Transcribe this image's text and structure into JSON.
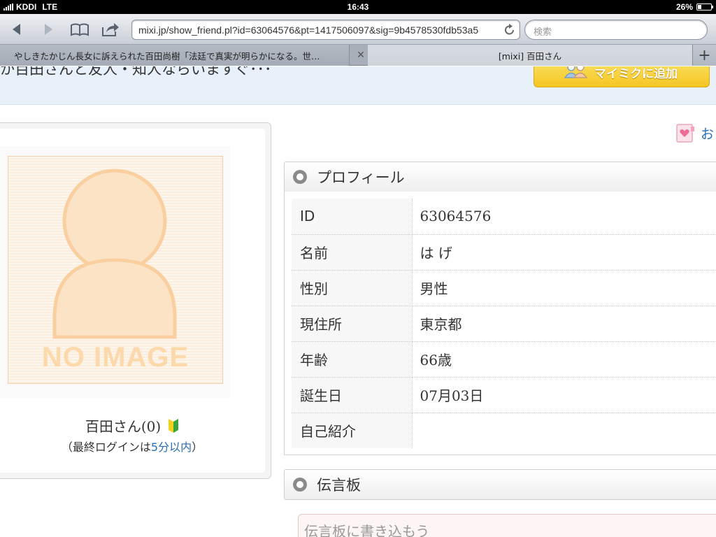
{
  "status_bar": {
    "carrier": "KDDI",
    "network": "LTE",
    "time": "16:43",
    "battery_percent": "26%",
    "battery_level": 0.26
  },
  "toolbar": {
    "url": "mixi.jp/show_friend.pl?id=63064576&pt=1417506097&sig=9b4578530fdb53a5",
    "search_placeholder": "検索",
    "icons": [
      "back-icon",
      "forward-icon",
      "bookmarks-icon",
      "share-icon",
      "reload-icon"
    ]
  },
  "tabs": [
    {
      "title": "やしきたかじん長女に訴えられた百田尚樹「法廷で真実が明らかになる。世…",
      "active": false
    },
    {
      "title": "[mixi] 百田さん",
      "active": true
    }
  ],
  "page": {
    "banner_text": "か百田さんと友人・知人ならいますぐ･･･",
    "mymixi_button": "マイミクに追加",
    "favorite_link": "お",
    "photo_label": "NO IMAGE",
    "user_name": "百田さん(0)",
    "last_login_prefix": "（最終ログインは",
    "last_login_value": "5分以内",
    "last_login_suffix": "）",
    "profile_section_title": "プロフィール",
    "profile_rows": [
      {
        "key": "ID",
        "value": "63064576"
      },
      {
        "key": "名前",
        "value": "は げ"
      },
      {
        "key": "性別",
        "value": "男性"
      },
      {
        "key": "現住所",
        "value": "東京都"
      },
      {
        "key": "年齢",
        "value": "66歳"
      },
      {
        "key": "誕生日",
        "value": "07月03日"
      },
      {
        "key": "自己紹介",
        "value": ""
      }
    ],
    "message_board_title": "伝言板",
    "message_placeholder": "伝言板に書き込もう"
  }
}
